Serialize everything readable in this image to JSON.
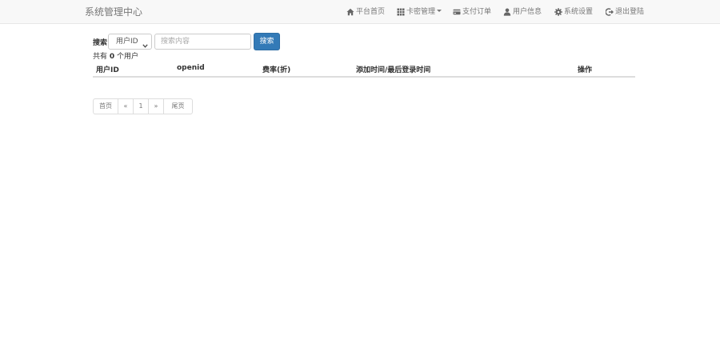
{
  "navbar": {
    "brand": "系统管理中心",
    "items": [
      {
        "label": "平台首页",
        "icon": "home-icon"
      },
      {
        "label": "卡密管理",
        "icon": "grid-icon",
        "dropdown": true
      },
      {
        "label": "支付订单",
        "icon": "credit-card-icon"
      },
      {
        "label": "用户信息",
        "icon": "user-icon"
      },
      {
        "label": "系统设置",
        "icon": "gear-icon"
      },
      {
        "label": "退出登陆",
        "icon": "logout-icon"
      }
    ]
  },
  "search": {
    "label": "搜索",
    "select_value": "用户ID",
    "placeholder": "搜索内容",
    "button_label": "搜索"
  },
  "summary": {
    "prefix": "共有",
    "count": "0",
    "suffix": "个用户"
  },
  "table": {
    "columns": [
      "用户ID",
      "openid",
      "费率(折)",
      "添加时间/最后登录时间",
      "操作"
    ],
    "rows": []
  },
  "pagination": {
    "items": [
      "首页",
      "«",
      "1",
      "»",
      "尾页"
    ]
  },
  "colors": {
    "primary": "#337ab7",
    "navbar_bg": "#f8f8f8",
    "nav_text": "#777777"
  }
}
